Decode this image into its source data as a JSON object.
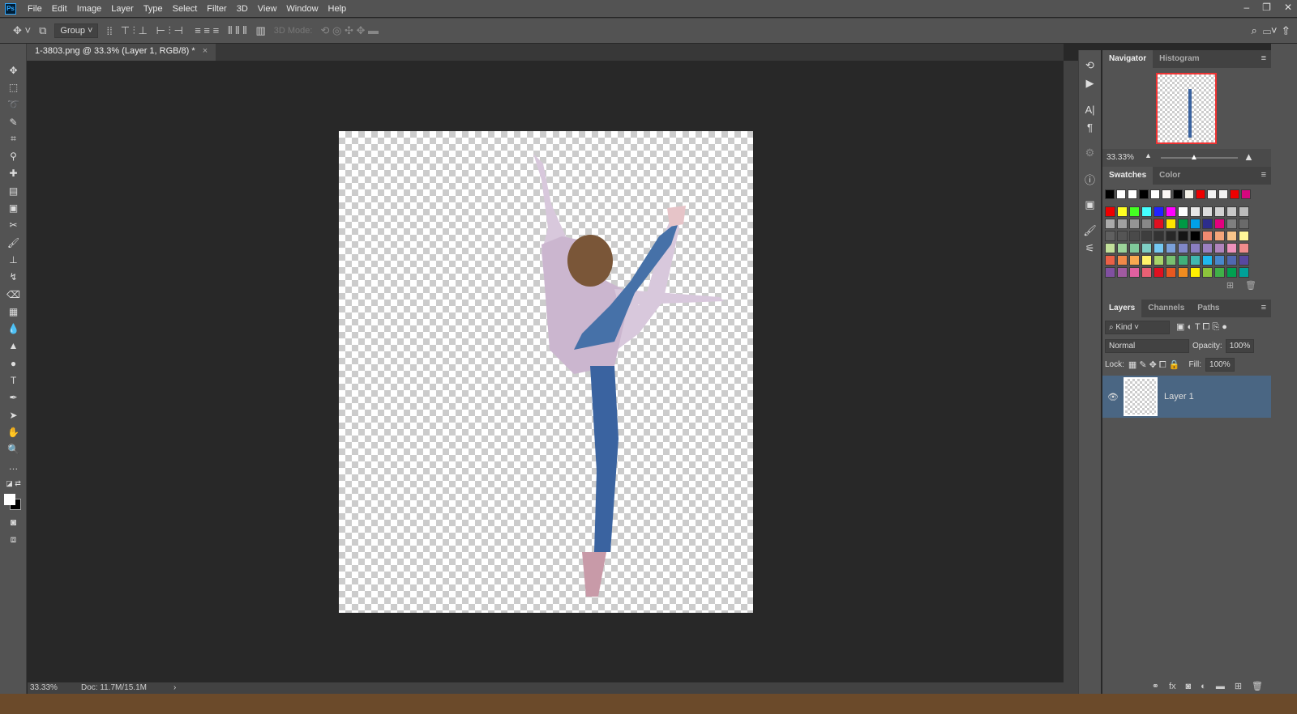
{
  "menu": [
    "File",
    "Edit",
    "Image",
    "Layer",
    "Type",
    "Select",
    "Filter",
    "3D",
    "View",
    "Window",
    "Help"
  ],
  "app_logo": "Ps",
  "options": {
    "auto_select": "Group",
    "mode3d": "3D Mode:"
  },
  "document_tab": {
    "title": "1-3803.png @ 33.3% (Layer 1, RGB/8) *",
    "close": "×"
  },
  "status": {
    "zoom": "33.33%",
    "doc": "Doc: 11.7M/15.1M",
    "arrow": "›"
  },
  "navigator": {
    "tabs": [
      "Navigator",
      "Histogram"
    ],
    "zoom": "33.33%"
  },
  "swatches": {
    "tabs": [
      "Swatches",
      "Color"
    ],
    "recent": [
      "#000000",
      "#ffffff",
      "#ffffff",
      "#000000",
      "#ffffff",
      "#fdf8f5",
      "#000000",
      "#f5f2e8",
      "#ee0000",
      "#f2f2f2",
      "#f2f2f2",
      "#ee0000",
      "#d6067e"
    ],
    "grid": [
      "#ee0000",
      "#ffff22",
      "#44ff22",
      "#44ffff",
      "#2222ff",
      "#ff00ff",
      "#ffffff",
      "#e8e8e8",
      "#dddddd",
      "#d2d2d2",
      "#c8c8c8",
      "#bbbbbb",
      "#aaaaaa",
      "#a0a0a0",
      "#959595",
      "#888888",
      "#e01020",
      "#ffe600",
      "#009944",
      "#00a0e9",
      "#2c2c8c",
      "#e4007f",
      "#7f7f7f",
      "#6a6a6a",
      "#606060",
      "#555555",
      "#4a4a4a",
      "#3e3e3e",
      "#333333",
      "#282828",
      "#151515",
      "#000000",
      "#f08a70",
      "#f4a57a",
      "#f8c48a",
      "#fff799",
      "#c2e09a",
      "#9cd49a",
      "#7fc89a",
      "#7fcfc4",
      "#74c8f2",
      "#7aa0da",
      "#8088c8",
      "#8a7ec0",
      "#9b80c0",
      "#b084bc",
      "#ee92bc",
      "#f08c8c",
      "#ea6046",
      "#f08848",
      "#f8a850",
      "#fff36a",
      "#a8d46a",
      "#78c070",
      "#40b07a",
      "#40b8b0",
      "#20b8ee",
      "#4888cc",
      "#5068b0",
      "#5848a0",
      "#8050a0",
      "#a05aa0",
      "#e060a0",
      "#e86074",
      "#e01020",
      "#e85820",
      "#f08c20",
      "#fff000",
      "#8cc43c",
      "#40b048",
      "#00a050",
      "#00a098"
    ]
  },
  "layers": {
    "tabs": [
      "Layers",
      "Channels",
      "Paths"
    ],
    "filter": "Kind",
    "blend": "Normal",
    "opacity_label": "Opacity:",
    "opacity": "100%",
    "lock_label": "Lock:",
    "fill_label": "Fill:",
    "fill": "100%",
    "items": [
      {
        "name": "Layer 1",
        "visible": true
      }
    ]
  }
}
